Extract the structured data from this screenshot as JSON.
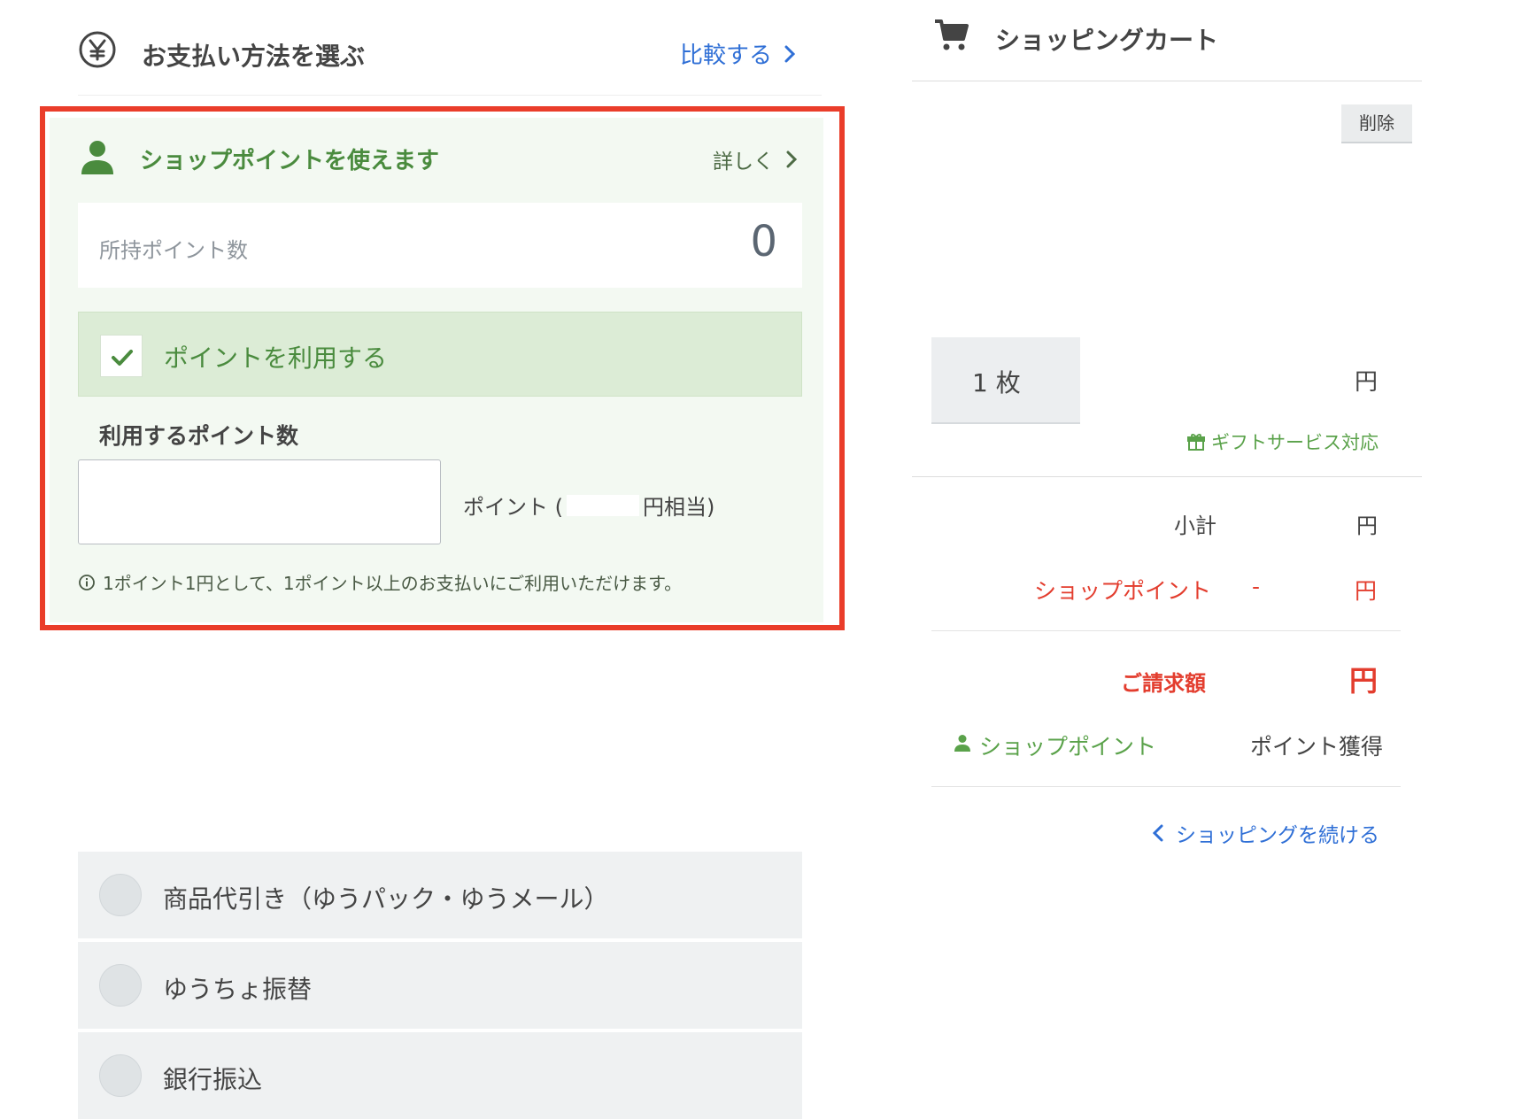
{
  "payment": {
    "title": "お支払い方法を選ぶ",
    "compare_label": "比較する"
  },
  "shop_point": {
    "title": "ショップポイントを使えます",
    "details_label": "詳しく",
    "owned_label": "所持ポイント数",
    "owned_value": "0",
    "use_label": "ポイントを利用する",
    "use_checked": true,
    "amount_label": "利用するポイント数",
    "amount_value": "",
    "equiv_prefix": "ポイント (",
    "equiv_suffix": "円相当)",
    "notice": "1ポイント1円として、1ポイント以上のお支払いにご利用いただけます。"
  },
  "payment_options": [
    {
      "label": "商品代引き（ゆうパック・ゆうメール）",
      "selected": false
    },
    {
      "label": "ゆうちょ振替",
      "selected": false
    },
    {
      "label": "銀行振込",
      "selected": false
    }
  ],
  "cart": {
    "title": "ショッピングカート",
    "delete_label": "削除",
    "quantity": "1 枚",
    "price_unit": "円",
    "gift_service": "ギフトサービス対応",
    "subtotal_label": "小計",
    "subtotal_unit": "円",
    "shop_point_label": "ショップポイント",
    "shop_point_minus": "-",
    "shop_point_unit": "円",
    "billing_label": "ご請求額",
    "billing_unit": "円",
    "earn_label": "ショップポイント",
    "earn_value": "ポイント獲得",
    "continue_label": "ショッピングを続ける"
  },
  "colors": {
    "highlight_border": "#ea3d2a",
    "green": "#4a8b3e",
    "link_blue": "#2f6fd6",
    "red": "#e33d2e"
  }
}
